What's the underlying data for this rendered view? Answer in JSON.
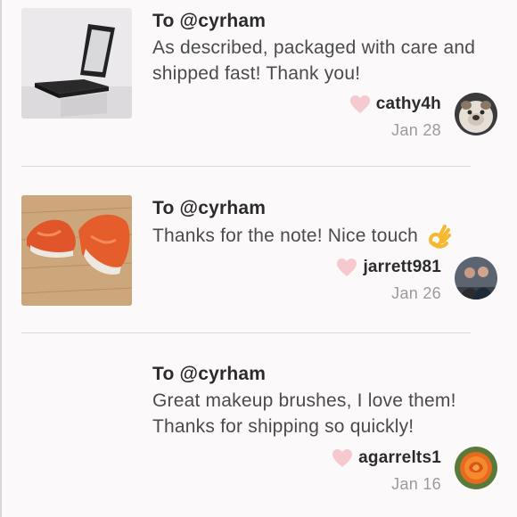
{
  "reviews": [
    {
      "title": "To @cyrham",
      "body": "As described, packaged with care and shipped fast! Thank you!",
      "username": "cathy4h",
      "date": "Jan 28",
      "thumbnail": "mirror-photo",
      "avatar": "bulldog-avatar"
    },
    {
      "title": "To @cyrham",
      "body": "Thanks for the note! Nice touch",
      "emoji": "ok-hand-emoji",
      "username": "jarrett981",
      "date": "Jan 26",
      "thumbnail": "sneakers-photo",
      "avatar": "couple-avatar"
    },
    {
      "title": "To @cyrham",
      "body": "Great makeup brushes, I love them! Thanks for shipping so quickly!",
      "username": "agarrelts1",
      "date": "Jan 16",
      "thumbnail": "",
      "avatar": "rose-avatar"
    }
  ],
  "colors": {
    "heart": "#f6c8cf",
    "divider": "#d9d9d9",
    "background": "#fbf9fa"
  }
}
